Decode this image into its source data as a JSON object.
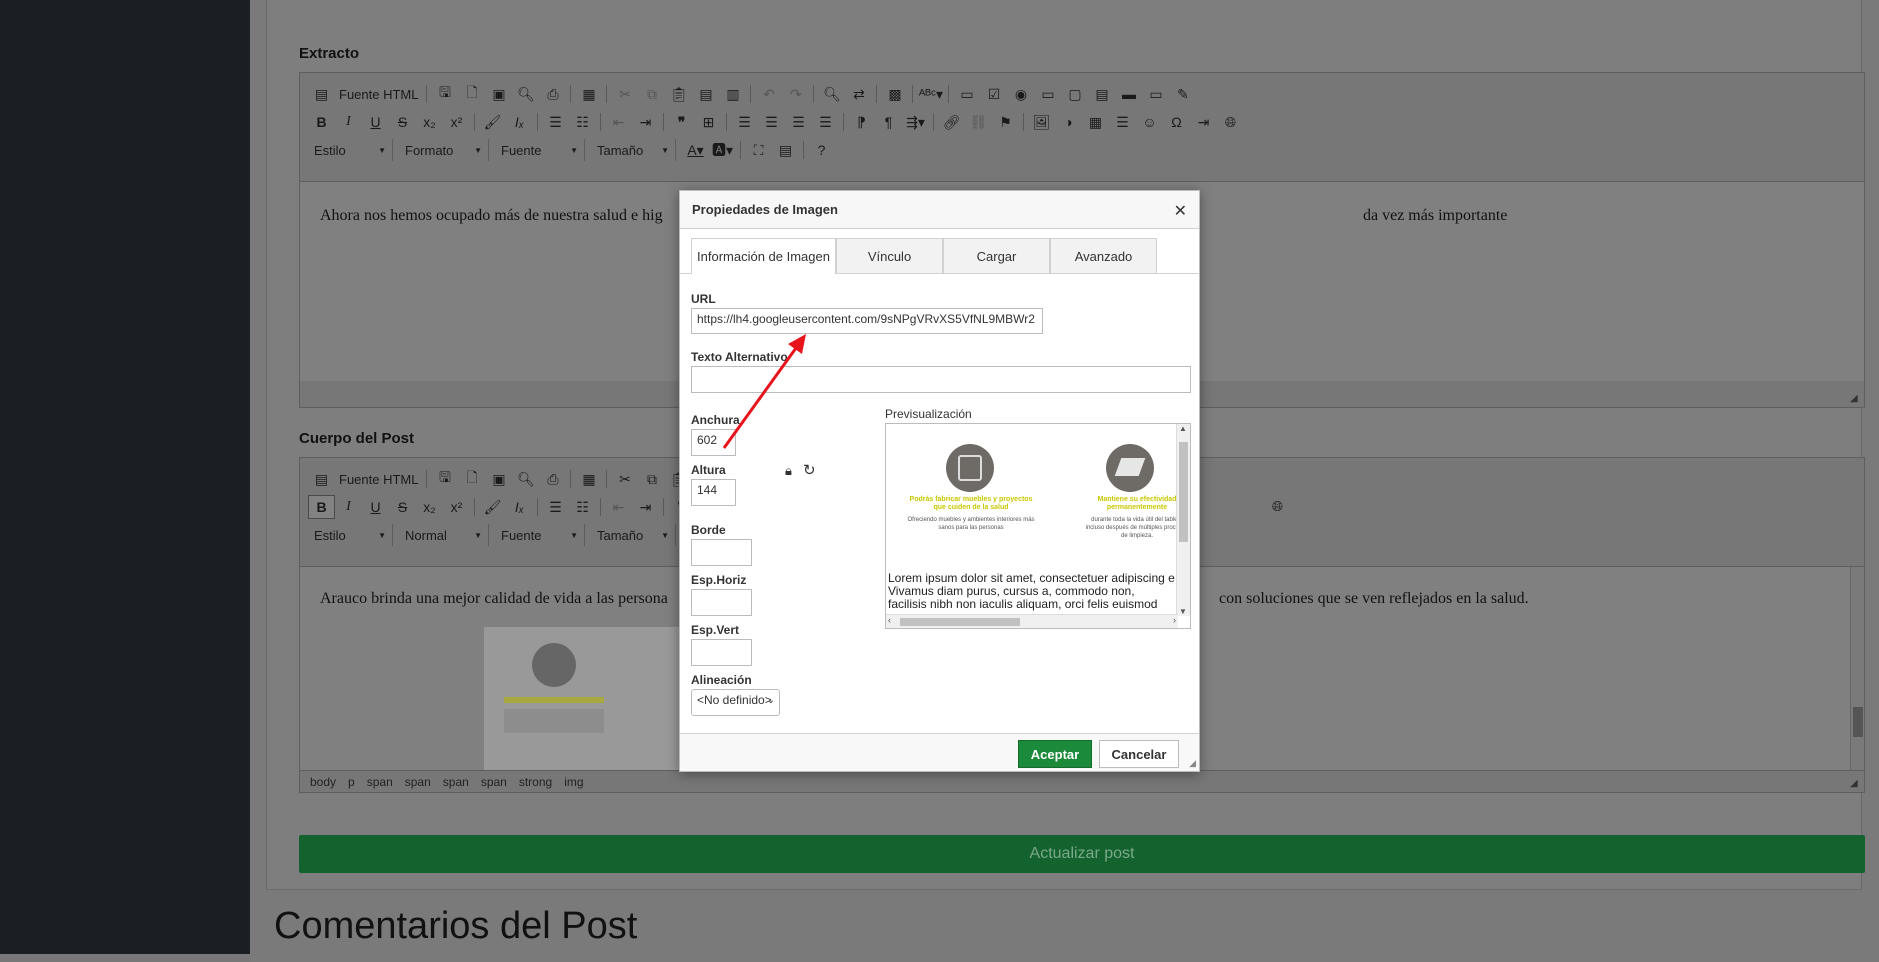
{
  "extracto": {
    "label": "Extracto",
    "toolbar": {
      "source_label": "Fuente HTML",
      "combos": [
        "Estilo",
        "Formato",
        "Fuente",
        "Tamaño"
      ]
    },
    "content": "Ahora nos hemos ocupado más de nuestra salud e hig",
    "content_tail": "da vez más importante"
  },
  "cuerpo": {
    "label": "Cuerpo del Post",
    "toolbar": {
      "source_label": "Fuente HTML",
      "combos": [
        "Estilo",
        "Normal",
        "Fuente",
        "Tamaño"
      ]
    },
    "content": "Arauco brinda una mejor calidad de vida a las persona",
    "content_tail": "con soluciones que se ven reflejados en la salud.",
    "statusbar": [
      "body",
      "p",
      "span",
      "span",
      "span",
      "span",
      "strong",
      "img"
    ]
  },
  "update_button": "Actualizar post",
  "comments_title": "Comentarios del Post",
  "dialog": {
    "title": "Propiedades de Imagen",
    "close": "✕",
    "tabs": [
      "Información de Imagen",
      "Vínculo",
      "Cargar",
      "Avanzado"
    ],
    "url_label": "URL",
    "url_value": "https://lh4.googleusercontent.com/9sNPgVRvXS5VfNL9MBWr2",
    "alt_label": "Texto Alternativo",
    "alt_value": "",
    "width_label": "Anchura",
    "width_value": "602",
    "height_label": "Altura",
    "height_value": "144",
    "border_label": "Borde",
    "hspace_label": "Esp.Horiz",
    "vspace_label": "Esp.Vert",
    "align_label": "Alineación",
    "align_value": "<No definido>",
    "preview_label": "Previsualización",
    "preview_card1_title": "Podrás fabricar muebles y proyectos que cuiden de la salud",
    "preview_card1_text": "Ofreciendo muebles y ambientes interiores más sanos para las personas",
    "preview_card2_title": "Mantiene su efectividad permanentemente",
    "preview_card2_text": "durante toda la vida útil del tablero incluso después de múltiples procesos de limpieza.",
    "preview_lorem": "Lorem ipsum dolor sit amet, consectetuer adipiscing e Vivamus diam purus, cursus a, commodo non, facilisis nibh non iaculis aliquam, orci felis euismod neque, sec",
    "ok": "Aceptar",
    "cancel": "Cancelar"
  },
  "colors": {
    "accept_green": "#1c8a3b",
    "annotation_arrow": "#e8141c",
    "preview_accent": "#c8c800"
  }
}
